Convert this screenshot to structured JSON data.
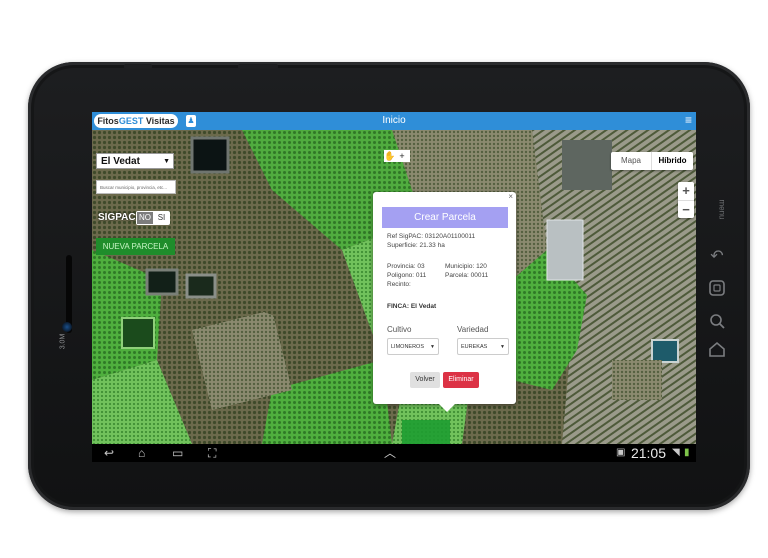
{
  "app": {
    "brand_part1": "Fitos",
    "brand_part2": "GEST",
    "brand_part3": " Visitas",
    "title": "Inicio"
  },
  "controls": {
    "finca_selected": "El Vedat",
    "search_placeholder": "Buscar municipio, provincia, etc...",
    "sigpac_label": "SIGPAC",
    "sigpac_no": "NO",
    "sigpac_si": "SI",
    "nueva_parcela": "NUEVA PARCELA"
  },
  "map_controls": {
    "mapa": "Mapa",
    "hibrido": "Híbrido",
    "zoom_in": "+",
    "zoom_out": "−",
    "draw_hand": "✋",
    "draw_plus": "+"
  },
  "popup": {
    "close": "×",
    "title": "Crear Parcela",
    "ref_sigpac": "Ref SigPAC: 03120A01100011",
    "superficie": "Superficie: 21.33 ha",
    "provincia": "Provincia: 03",
    "municipio": "Municipio: 120",
    "poligono": "Poligono: 011",
    "parcela": "Parcela: 00011",
    "recinto": "Recinto:",
    "finca": "FINCA: El Vedat",
    "cultivo_label": "Cultivo",
    "variedad_label": "Variedad",
    "cultivo_value": "LIMONEROS",
    "variedad_value": "EUREKAS",
    "volver": "Volver",
    "eliminar": "Eliminar"
  },
  "system_bar": {
    "time": "21:05"
  },
  "device": {
    "camera_label": "3.0M",
    "menu_label": "menu"
  },
  "colors": {
    "appbar": "#2f8ed8",
    "popup_title": "#a4a0f2",
    "eliminar": "#dc3245",
    "nueva_parcela": "#1f8d2b"
  }
}
